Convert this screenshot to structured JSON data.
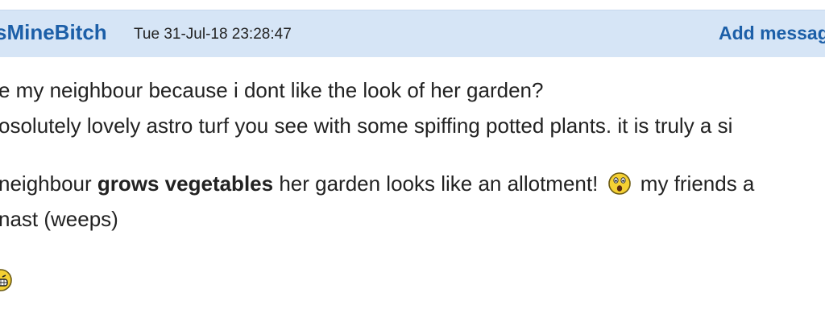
{
  "header": {
    "username": "sMineBitch",
    "timestamp": "Tue 31-Jul-18 23:28:47",
    "add_message_label": "Add messag"
  },
  "body": {
    "line1": "e my neighbour because i dont like the look of her garden?",
    "line2": "osolutely lovely astro turf you see with some spiffing potted plants. it is truly a si",
    "line3_before": "neighbour ",
    "line3_bold": "grows vegetables",
    "line3_after": " her garden looks like an allotment!",
    "line3_tail": " my friends a",
    "line4": "nast (weeps)"
  },
  "icons": {
    "inline_emoji": "shocked-face-icon",
    "bottom_emoji": "grinning-face-icon"
  },
  "colors": {
    "header_bg": "#d6e5f6",
    "link": "#1c5fa8",
    "emoji_yellow": "#f5d033"
  }
}
